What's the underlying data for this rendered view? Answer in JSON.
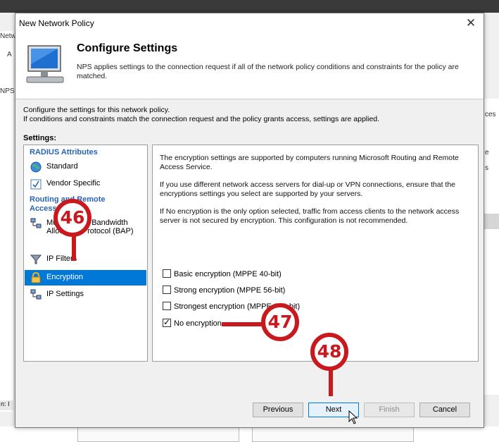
{
  "background": {
    "left_fragments": [
      "Netw",
      "A",
      "NPS"
    ],
    "right_fragments": [
      "ces",
      "e",
      "s"
    ],
    "status_text": "n: I"
  },
  "dialog": {
    "title": "New Network Policy",
    "close_glyph": "✕",
    "header": {
      "title": "Configure Settings",
      "description": "NPS applies settings to the connection request if all of the network policy conditions and constraints for the policy are matched."
    },
    "intro_line1": "Configure the settings for this network policy.",
    "intro_line2": "If conditions and constraints match the connection request and the policy grants access, settings are applied.",
    "settings_label": "Settings:",
    "categories": {
      "radius": "RADIUS Attributes",
      "routing": "Routing and Remote Access"
    },
    "items": {
      "standard": "Standard",
      "vendor_specific": "Vendor Specific",
      "multilink": "Multilink and Bandwidth Allocation Protocol (BAP)",
      "ip_filters": "IP Filters",
      "encryption": "Encryption",
      "ip_settings": "IP Settings"
    },
    "content": {
      "para1": "The encryption settings are supported by computers running Microsoft Routing and Remote Access Service.",
      "para2": "If you use different network access servers for dial-up or VPN connections, ensure that the encryptions settings you select are supported by your servers.",
      "para3": "If No encryption is the only option selected, traffic from access clients to the network access server is not secured by encryption. This configuration is not recommended."
    },
    "options": [
      {
        "label": "Basic encryption (MPPE 40-bit)",
        "checked": false
      },
      {
        "label": "Strong encryption (MPPE 56-bit)",
        "checked": false
      },
      {
        "label": "Strongest encryption (MPPE 128-bit)",
        "checked": false
      },
      {
        "label": "No encryption",
        "checked": true
      }
    ],
    "buttons": {
      "previous": "Previous",
      "next": "Next",
      "finish": "Finish",
      "cancel": "Cancel"
    }
  },
  "callouts": {
    "c46": "46",
    "c47": "47",
    "c48": "48"
  },
  "colors": {
    "accent": "#0078d7",
    "callout": "#c8191e",
    "category": "#2a63b5"
  }
}
